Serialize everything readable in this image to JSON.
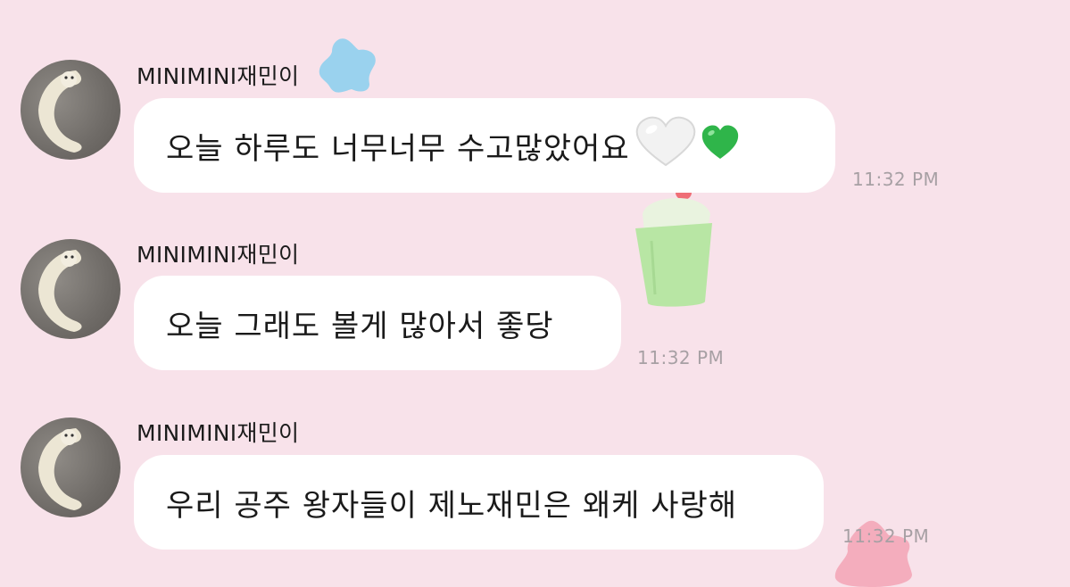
{
  "messages": [
    {
      "sender": "MINIMINI재민이",
      "text": "오늘 하루도 너무너무 수고많았어요",
      "emoji": "🤍💚",
      "time": "11:32 PM"
    },
    {
      "sender": "MINIMINI재민이",
      "text": "오늘 그래도 볼게 많아서 좋당",
      "time": "11:32 PM"
    },
    {
      "sender": "MINIMINI재민이",
      "text": "우리 공주 왕자들이 제노재민은 왜케 사랑해",
      "time": "11:32 PM"
    }
  ],
  "colors": {
    "background": "#f8e2ea",
    "bubble": "#ffffff",
    "timestamp": "#a7a0a4",
    "sticker_blue": "#8fd0ee",
    "sticker_green": "#b8e6a4",
    "sticker_pink": "#f3a7b8"
  }
}
